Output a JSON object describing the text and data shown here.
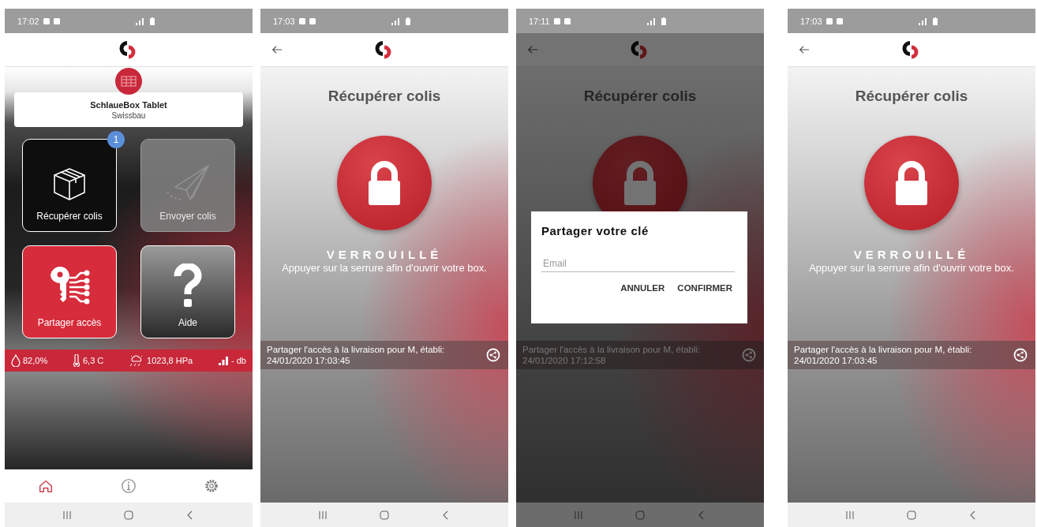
{
  "screens": [
    {
      "kind": "home",
      "status_bar": {
        "time": "17:02"
      },
      "device": {
        "name": "SchlaueBox Tablet",
        "owner": "Swissbau"
      },
      "tiles": [
        {
          "kind": "box",
          "label": "Récupérer colis",
          "badge": "1",
          "disabled": false
        },
        {
          "kind": "plane",
          "label": "Envoyer colis",
          "disabled": true
        },
        {
          "kind": "key",
          "label": "Partager accès",
          "disabled": false
        },
        {
          "kind": "help",
          "label": "Aide",
          "disabled": false
        }
      ],
      "sensors": [
        {
          "kind": "humidity",
          "value": "82,0%"
        },
        {
          "kind": "temperature",
          "value": "6,3 C"
        },
        {
          "kind": "pressure",
          "value": "1023,8 HPa"
        },
        {
          "kind": "signal",
          "value": "- db"
        }
      ],
      "bottom_nav": [
        {
          "kind": "home",
          "selected": true
        },
        {
          "kind": "info",
          "selected": false
        },
        {
          "kind": "settings",
          "selected": false
        }
      ]
    },
    {
      "kind": "lock",
      "status_bar": {
        "time": "17:03"
      },
      "title": "Récupérer colis",
      "locked": true,
      "lock_label": "VERROUILLÉ",
      "hint": "Appuyer sur la serrure afin d'ouvrir votre box.",
      "share": {
        "text": "Partager l'accès à la livraison pour M, établi:",
        "date": "24/01/2020 17:03:45"
      }
    },
    {
      "kind": "lock",
      "status_bar": {
        "time": "17:11"
      },
      "title": "Récupérer colis",
      "locked": true,
      "share": {
        "text": "Partager l'accès à la livraison pour M, établi:",
        "date": "24/01/2020 17:12:58"
      },
      "dialog": {
        "title": "Partager votre clé",
        "placeholder": "Email",
        "buttons": [
          "ANNULER",
          "CONFIRMER"
        ]
      }
    },
    {
      "kind": "lock",
      "status_bar": {
        "time": "17:03"
      },
      "title": "Récupérer colis",
      "locked": true,
      "lock_label": "VERROUILLÉ",
      "hint": "Appuyer sur la serrure afin d'ouvrir votre box.",
      "share": {
        "text": "Partager l'accès à la livraison pour M, établi:",
        "date": "24/01/2020 17:03:45"
      }
    }
  ]
}
